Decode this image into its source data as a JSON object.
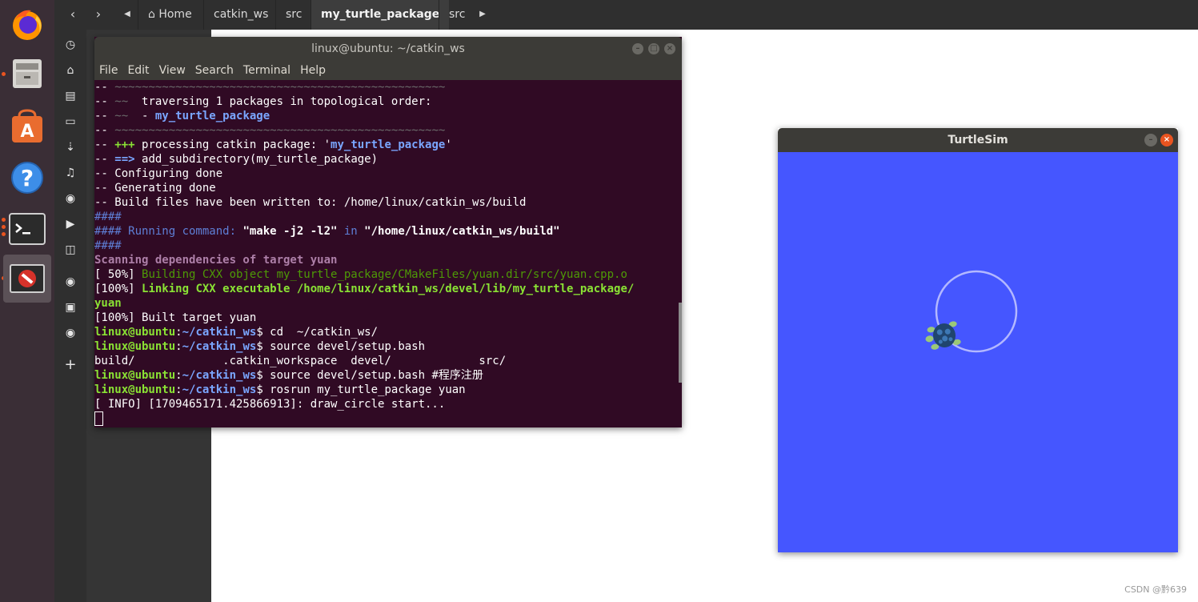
{
  "nautilus": {
    "breadcrumbs": [
      "Home",
      "catkin_ws",
      "src",
      "my_turtle_package",
      "src"
    ]
  },
  "terminal": {
    "title": "linux@ubuntu: ~/catkin_ws",
    "menu": [
      "File",
      "Edit",
      "View",
      "Search",
      "Terminal",
      "Help"
    ],
    "lines": [
      [
        {
          "t": "-- ",
          "c": "#ffffff"
        },
        {
          "t": "~~~~~~~~~~~~~~~~~~~~~~~~~~~~~~~~~~~~~~~~~~~~~~~~~",
          "c": "#6b6b6b"
        }
      ],
      [
        {
          "t": "-- ",
          "c": "#ffffff"
        },
        {
          "t": "~~",
          "c": "#6b6b6b"
        },
        {
          "t": "  traversing 1 packages in topological order:",
          "c": "#ffffff"
        }
      ],
      [
        {
          "t": "-- ",
          "c": "#ffffff"
        },
        {
          "t": "~~",
          "c": "#6b6b6b"
        },
        {
          "t": "  - ",
          "c": "#ffffff"
        },
        {
          "t": "my_turtle_package",
          "c": "#7aa6ff",
          "b": true
        }
      ],
      [
        {
          "t": "-- ",
          "c": "#ffffff"
        },
        {
          "t": "~~~~~~~~~~~~~~~~~~~~~~~~~~~~~~~~~~~~~~~~~~~~~~~~~",
          "c": "#6b6b6b"
        }
      ],
      [
        {
          "t": "-- ",
          "c": "#ffffff"
        },
        {
          "t": "+++",
          "c": "#8ae234",
          "b": true
        },
        {
          "t": " processing catkin package: '",
          "c": "#ffffff"
        },
        {
          "t": "my_turtle_package",
          "c": "#7aa6ff",
          "b": true
        },
        {
          "t": "'",
          "c": "#ffffff"
        }
      ],
      [
        {
          "t": "-- ",
          "c": "#ffffff"
        },
        {
          "t": "==>",
          "c": "#7aa6ff",
          "b": true
        },
        {
          "t": " add_subdirectory(my_turtle_package)",
          "c": "#ffffff"
        }
      ],
      [
        {
          "t": "-- Configuring done",
          "c": "#ffffff"
        }
      ],
      [
        {
          "t": "-- Generating done",
          "c": "#ffffff"
        }
      ],
      [
        {
          "t": "-- Build files have been written to: /home/linux/catkin_ws/build",
          "c": "#ffffff"
        }
      ],
      [
        {
          "t": "####",
          "c": "#5e7fd6"
        }
      ],
      [
        {
          "t": "#### Running command: ",
          "c": "#5e7fd6"
        },
        {
          "t": "\"make -j2 -l2\"",
          "c": "#ffffff",
          "b": true
        },
        {
          "t": " in ",
          "c": "#5e7fd6"
        },
        {
          "t": "\"/home/linux/catkin_ws/build\"",
          "c": "#ffffff",
          "b": true
        }
      ],
      [
        {
          "t": "####",
          "c": "#5e7fd6"
        }
      ],
      [
        {
          "t": "Scanning dependencies of target yuan",
          "c": "#ad7fa8",
          "b": true
        }
      ],
      [
        {
          "t": "[ 50%] ",
          "c": "#ffffff"
        },
        {
          "t": "Building CXX object my_turtle_package/CMakeFiles/yuan.dir/src/yuan.cpp.o",
          "c": "#4e9a06"
        }
      ],
      [
        {
          "t": "[100%] ",
          "c": "#ffffff"
        },
        {
          "t": "Linking CXX executable /home/linux/catkin_ws/devel/lib/my_turtle_package/",
          "c": "#8ae234",
          "b": true
        }
      ],
      [
        {
          "t": "yuan",
          "c": "#8ae234",
          "b": true
        }
      ],
      [
        {
          "t": "[100%] Built target yuan",
          "c": "#ffffff"
        }
      ],
      [
        {
          "t": "linux@ubuntu",
          "c": "#8ae234",
          "b": true
        },
        {
          "t": ":",
          "c": "#ffffff"
        },
        {
          "t": "~/catkin_ws",
          "c": "#7aa6ff",
          "b": true
        },
        {
          "t": "$ cd  ~/catkin_ws/",
          "c": "#ffffff"
        }
      ],
      [
        {
          "t": "linux@ubuntu",
          "c": "#8ae234",
          "b": true
        },
        {
          "t": ":",
          "c": "#ffffff"
        },
        {
          "t": "~/catkin_ws",
          "c": "#7aa6ff",
          "b": true
        },
        {
          "t": "$ source devel/setup.bash",
          "c": "#ffffff"
        }
      ],
      [
        {
          "t": "build/             .catkin_workspace  devel/             src/",
          "c": "#ffffff"
        }
      ],
      [
        {
          "t": "linux@ubuntu",
          "c": "#8ae234",
          "b": true
        },
        {
          "t": ":",
          "c": "#ffffff"
        },
        {
          "t": "~/catkin_ws",
          "c": "#7aa6ff",
          "b": true
        },
        {
          "t": "$ source devel/setup.bash #程序注册",
          "c": "#ffffff"
        }
      ],
      [
        {
          "t": "linux@ubuntu",
          "c": "#8ae234",
          "b": true
        },
        {
          "t": ":",
          "c": "#ffffff"
        },
        {
          "t": "~/catkin_ws",
          "c": "#7aa6ff",
          "b": true
        },
        {
          "t": "$ rosrun my_turtle_package yuan",
          "c": "#ffffff"
        }
      ],
      [
        {
          "t": "[ INFO] [1709465171.425866913]: draw_circle start...",
          "c": "#ffffff"
        }
      ]
    ]
  },
  "turtlesim": {
    "title": "TurtleSim",
    "background_color": "#4556ff",
    "pen_color": "#b3b8ff"
  },
  "watermark": "CSDN @黔639",
  "colors": {
    "dock_bg": "#3a2e36",
    "ubuntu_orange": "#e95420",
    "terminal_bg": "#300a24"
  }
}
